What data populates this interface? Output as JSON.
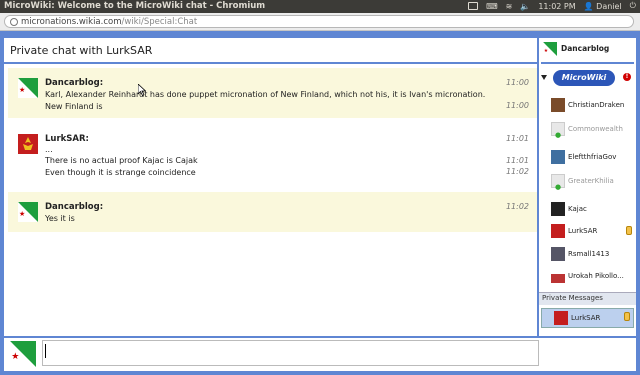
{
  "window": {
    "title": "MicroWiki: Welcome to the MicroWiki chat - Chromium",
    "clock": "11:02 PM",
    "user": "Daniel"
  },
  "browser": {
    "url_domain": "micronations.wikia.com",
    "url_path": "/wiki/Special:Chat"
  },
  "chat": {
    "header": "Private chat with LurkSAR",
    "messages": [
      {
        "author": "Dancarblog:",
        "avatar_icon": "flag-avatar-icon",
        "lines": [
          {
            "text": "Karl, Alexander Reinhardt has done puppet micronation of New Finland, which not his, it is Ivan's micronation.",
            "time": "11:00"
          },
          {
            "text": "New Finland is",
            "time": "11:00"
          }
        ]
      },
      {
        "author": "LurkSAR:",
        "avatar_icon": "emblem-avatar-icon",
        "lines": [
          {
            "text": "...",
            "time": "11:01"
          },
          {
            "text": "There is no actual proof Kajac is Cajak",
            "time": "11:01"
          },
          {
            "text": "Even though it is strange coincidence",
            "time": "11:02"
          }
        ]
      },
      {
        "author": "Dancarblog:",
        "avatar_icon": "flag-avatar-icon",
        "lines": [
          {
            "text": "Yes it is",
            "time": "11:02"
          }
        ]
      }
    ],
    "input_value": ""
  },
  "sidebar": {
    "me": "Dancarblog",
    "wiki_logo_text": "MicroWiki",
    "wiki_badge": "!",
    "users": [
      {
        "name": "ChristianDraken",
        "away": false,
        "medal": false
      },
      {
        "name": "Commonwealth",
        "away": true,
        "medal": false
      },
      {
        "name": "EleftthfriaGov",
        "away": false,
        "medal": false
      },
      {
        "name": "GreaterKhilia",
        "away": true,
        "medal": false
      },
      {
        "name": "Kajac",
        "away": false,
        "medal": false
      },
      {
        "name": "LurkSAR",
        "away": false,
        "medal": true
      },
      {
        "name": "Rsmall1413",
        "away": false,
        "medal": false
      },
      {
        "name": "Urokah Pikollo...",
        "away": false,
        "medal": false
      }
    ],
    "private_messages_label": "Private Messages",
    "private_messages": [
      {
        "name": "LurkSAR"
      }
    ]
  },
  "colors": {
    "accent": "#5f86d3",
    "highlight_row": "#faf8dc",
    "pm_selected": "#bcd0ee"
  }
}
